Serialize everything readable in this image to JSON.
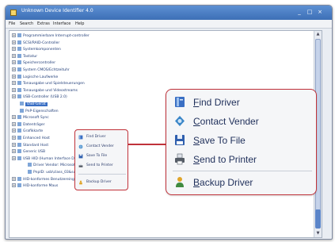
{
  "window": {
    "title": "Unknown Device Identifier 4.0",
    "controls": [
      "_",
      "□",
      "×"
    ]
  },
  "menubar": [
    "File",
    "Search",
    "Extras",
    "Interface",
    "Help"
  ],
  "tree": [
    {
      "label": "Programmierbare Interrupt-controller",
      "level": 0
    },
    {
      "label": "SCSI/RAID-Controller",
      "level": 0
    },
    {
      "label": "Systemkomponenten",
      "level": 0
    },
    {
      "label": "Tastatur",
      "level": 0
    },
    {
      "label": "Speichercontroller",
      "level": 0
    },
    {
      "label": "System CMOS/Echtzeituhr",
      "level": 0
    },
    {
      "label": "Logische Laufwerke",
      "level": 0
    },
    {
      "label": "Tonausgabe und Spielsteuerungen",
      "level": 0
    },
    {
      "label": "Tonausgabe und Videostreams",
      "level": 0
    },
    {
      "label": "USB-Controller (USB 2.0)",
      "level": 0
    },
    {
      "label": "USB-Gerät",
      "level": 1,
      "selected": true
    },
    {
      "label": "PnP-Eigenschaften",
      "level": 1
    },
    {
      "label": "Microsoft Sync",
      "level": 0
    },
    {
      "label": "Datenträger",
      "level": 0
    },
    {
      "label": "Grafikkarte",
      "level": 0
    },
    {
      "label": "Enhanced Host",
      "level": 0
    },
    {
      "label": "Standard Host",
      "level": 0
    },
    {
      "label": "Generic USB",
      "level": 0
    },
    {
      "label": "USB HID (Human Interface Device)",
      "level": 0
    },
    {
      "label": "Driver Vendor: Microsoft",
      "level": 2
    },
    {
      "label": "PnpID: usb\\class_03&subclass_01",
      "level": 2
    },
    {
      "label": "HID-konformes Benutzereingabegerät",
      "level": 0
    },
    {
      "label": "HID-konforme Maus",
      "level": 0
    }
  ],
  "context_menu": {
    "items": [
      {
        "label": "Find Driver",
        "underline": "F",
        "rest": "ind Driver",
        "icon": "book-icon",
        "color": "#3a6fc4"
      },
      {
        "label": "Contact Vender",
        "underline": "C",
        "rest": "ontact Vender",
        "icon": "globe-icon",
        "color": "#3a86c8"
      },
      {
        "label": "Save To File",
        "underline": "S",
        "rest": "ave To File",
        "icon": "floppy-disk-icon",
        "color": "#2f5fae"
      },
      {
        "label": "Send to Printer",
        "underline": "S",
        "rest": "end to Printer",
        "icon": "printer-icon",
        "color": "#555c66"
      },
      {
        "label": "Backup Driver",
        "underline": "B",
        "rest": "ackup Driver",
        "icon": "person-upload-icon",
        "color": "#e0a52a"
      }
    ]
  },
  "colors": {
    "highlight_border": "#c0323a",
    "title_bar": "#3d6fb6",
    "tree_text": "#24407a"
  }
}
